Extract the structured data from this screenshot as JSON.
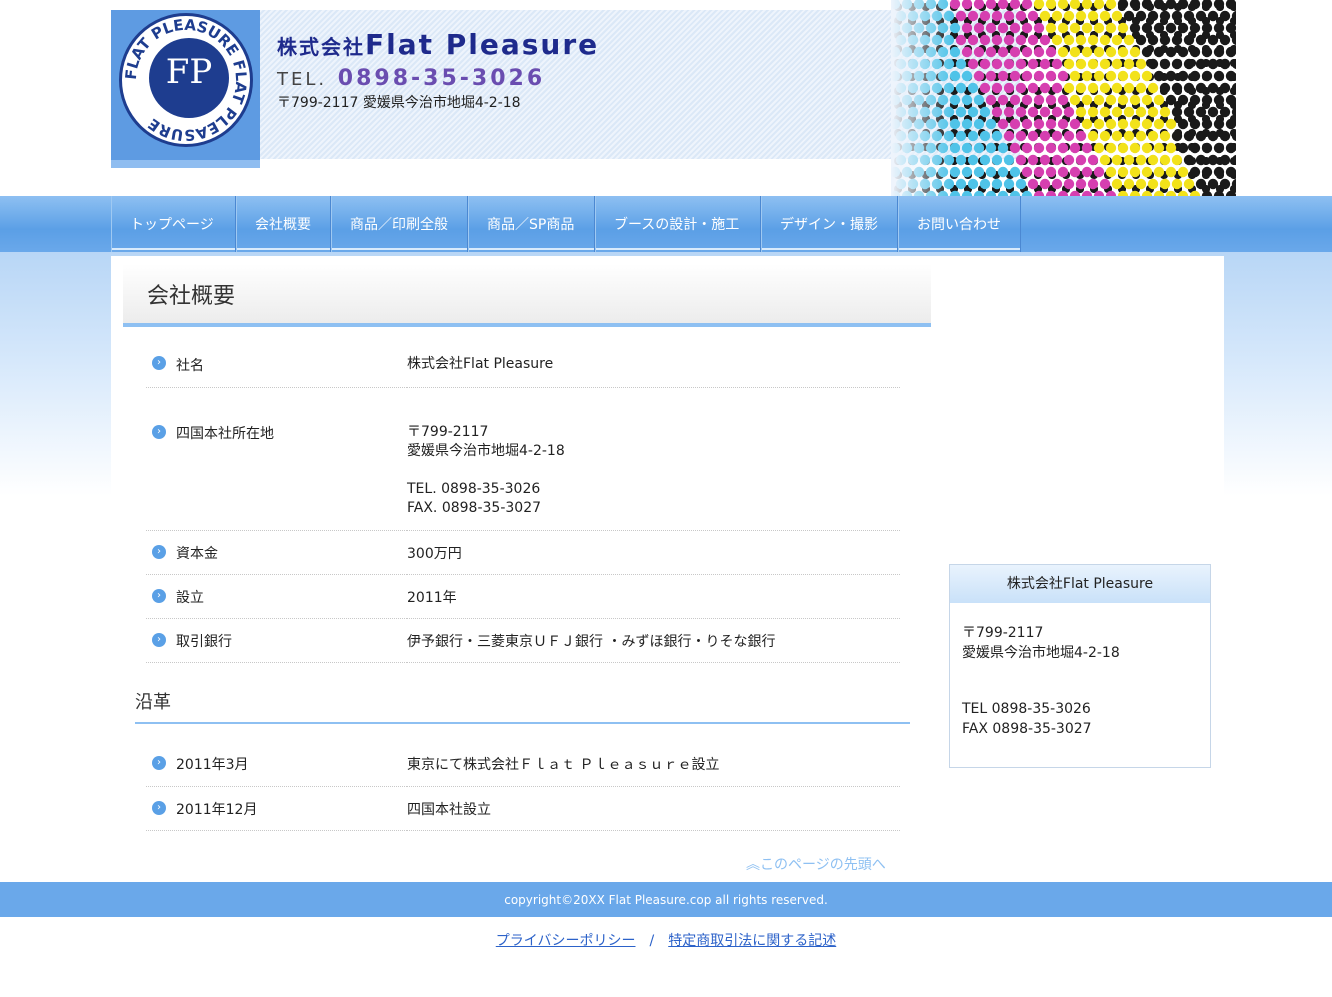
{
  "header": {
    "company_prefix": "株式会社",
    "company_name": "Flat Pleasure",
    "tel_label": "TEL.",
    "tel_number": "0898-35-3026",
    "address": "〒799-2117 愛媛県今治市地堀4-2-18",
    "logo_text": "FP",
    "logo_ring_text": "FLAT PLEASURE FLAT PLEASURE"
  },
  "nav": {
    "items": [
      {
        "label": "トップページ"
      },
      {
        "label": "会社概要"
      },
      {
        "label": "商品／印刷全般"
      },
      {
        "label": "商品／SP商品"
      },
      {
        "label": "ブースの設計・施工"
      },
      {
        "label": "デザイン・撮影"
      },
      {
        "label": "お問い合わせ"
      }
    ]
  },
  "main": {
    "title": "会社概要",
    "company_rows": [
      {
        "label": "社名",
        "value": [
          "株式会社Flat Pleasure"
        ]
      },
      {
        "label": "四国本社所在地",
        "value": [
          "〒799-2117",
          "愛媛県今治市地堀4-2-18",
          "",
          "TEL. 0898-35-3026",
          "FAX. 0898-35-3027"
        ]
      },
      {
        "label": "資本金",
        "value": [
          "300万円"
        ]
      },
      {
        "label": "設立",
        "value": [
          "2011年"
        ]
      },
      {
        "label": "取引銀行",
        "value": [
          "伊予銀行・三菱東京ＵＦＪ銀行 ・みずほ銀行・りそな銀行"
        ]
      }
    ],
    "history_title": "沿革",
    "history_rows": [
      {
        "label": "2011年3月",
        "value": [
          "東京にて株式会社Ｆｌａｔ Ｐｌｅａｓｕｒｅ設立"
        ]
      },
      {
        "label": "2011年12月",
        "value": [
          "四国本社設立"
        ]
      }
    ],
    "pagetop": "このページの先頭へ"
  },
  "sidebar": {
    "title": "株式会社Flat Pleasure",
    "postal": "〒799-2117",
    "address": "愛媛県今治市地堀4-2-18",
    "tel": "TEL 0898-35-3026",
    "fax": "FAX 0898-35-3027"
  },
  "footer": {
    "copyright": "copyright©20XX Flat Pleasure.cop all rights reserved.",
    "privacy": "プライバシーポリシー",
    "separator": "/",
    "law": "特定商取引法に関する記述"
  },
  "colors": {
    "accent": "#6aa8ea",
    "brand_navy": "#1e2a8c",
    "tel_purple": "#6a4db0",
    "link": "#2c62c9"
  }
}
